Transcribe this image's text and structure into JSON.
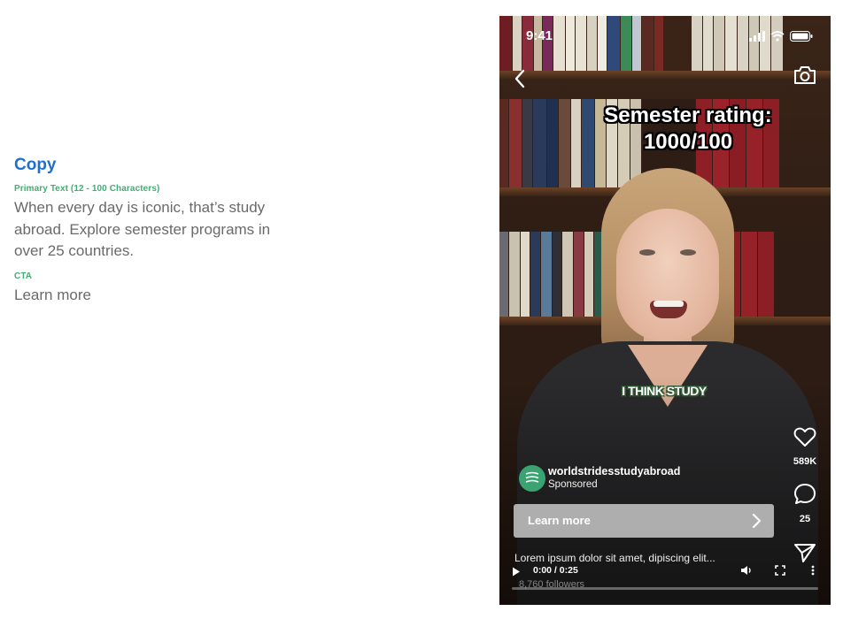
{
  "copy_panel": {
    "title": "Copy",
    "primary_text_label": "Primary Text (12 - 100 Characters)",
    "primary_text": "When every day is iconic, that’s study abroad. Explore semester programs in over 25 countries.",
    "cta_label": "CTA",
    "cta_value": "Learn more"
  },
  "phone": {
    "status_time": "9:41",
    "headline_line1": "Semester rating:",
    "headline_line2": "1000/100",
    "caption": "I THINK STUDY",
    "likes_count": "589K",
    "comments_count": "25",
    "account_name": "worldstridesstudyabroad",
    "account_sub": "Sponsored",
    "cta_button_label": "Learn more",
    "description": "Lorem ipsum dolor sit amet, dipiscing elit...",
    "followers": "8,760 followers",
    "time_display": "0:00 / 0:25",
    "progress": 0
  },
  "icons": [
    "back-icon",
    "camera-icon",
    "heart-icon",
    "comment-icon",
    "share-icon",
    "play-icon",
    "volume-icon",
    "fullscreen-icon",
    "more-icon",
    "chevron-right-icon",
    "signal-icon",
    "wifi-icon",
    "battery-icon"
  ],
  "colors": {
    "copy_title": "#1f6fd1",
    "field_label": "#3fae74",
    "avatar": "#3aa372"
  }
}
